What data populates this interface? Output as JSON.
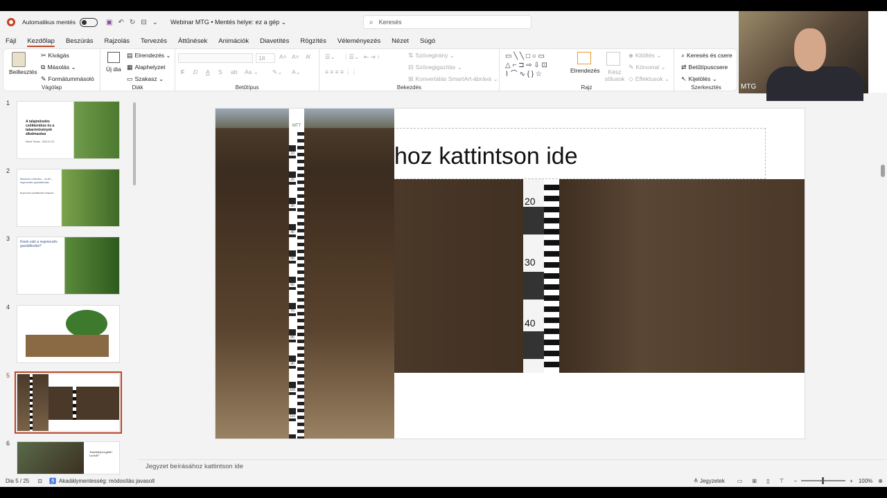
{
  "titlebar": {
    "autosave_label": "Automatikus mentés",
    "doc_title": "Webinar MTG • Mentés helye: ez a gép ⌄",
    "search_placeholder": "Keresés"
  },
  "menu": {
    "tabs": [
      "Fájl",
      "Kezdőlap",
      "Beszúrás",
      "Rajzolás",
      "Tervezés",
      "Áttűnések",
      "Animációk",
      "Diavetítés",
      "Rögzítés",
      "Véleményezés",
      "Nézet",
      "Súgó"
    ],
    "active_tab": "Kezdőlap"
  },
  "ribbon": {
    "clipboard": {
      "paste": "Beillesztés",
      "cut": "Kivágás",
      "copy": "Másolás",
      "format_painter": "Formátummásoló",
      "label": "Vágólap"
    },
    "slides": {
      "new_slide": "Új dia",
      "layout": "Elrendezés",
      "reset": "Alaphelyzet",
      "section": "Szakasz",
      "label": "Diák"
    },
    "font": {
      "size": "18",
      "label": "Betűtípus",
      "bold": "F",
      "italic": "D",
      "underline": "A",
      "strike": "S",
      "case": "Aa"
    },
    "paragraph": {
      "text_direction": "Szövegirány",
      "align_text": "Szövegigazítás",
      "smartart": "Konvertálás SmartArt-ábrává",
      "label": "Bekezdés"
    },
    "drawing": {
      "arrange": "Elrendezés",
      "quick_styles": "Kész stílusok",
      "fill": "Kitöltés",
      "outline": "Körvonal",
      "effects": "Effektusok",
      "label": "Rajz"
    },
    "editing": {
      "find_replace": "Keresés és csere",
      "replace_fonts": "Betűtípuscsere",
      "select": "Kijelölés",
      "label": "Szerkesztés"
    }
  },
  "slides_pane": {
    "thumbs": [
      {
        "num": "1",
        "text": "A talajművelés csökkentése és a takarónövények alkalmazása",
        "sub": "Mezei Tamás - 2024.01.23"
      },
      {
        "num": "2",
        "text": "Minimum művelés – no-till – regeneratív gazdálkodás",
        "sub": "Regeneratív gazdálkodás 5 alapelve"
      },
      {
        "num": "3",
        "text": "Kinek való a regeneratív gazdálkodás?",
        "sub": ""
      },
      {
        "num": "4",
        "text": "",
        "sub": ""
      },
      {
        "num": "5",
        "text": "",
        "sub": ""
      },
      {
        "num": "6",
        "text": "Termőtalajvizsgálat? Laz/tali?",
        "sub": ""
      }
    ],
    "selected": 4
  },
  "slide": {
    "title": "hoz kattintson ide",
    "ruler_left_marks": [
      "10",
      "20",
      "30",
      "40",
      "50",
      "60",
      "70",
      "80",
      "90",
      "100",
      "110"
    ],
    "ruler_left_logo": "MTT",
    "ruler_right_marks": [
      "20",
      "30",
      "40"
    ]
  },
  "notes": {
    "placeholder": "Jegyzet beírásához kattintson ide"
  },
  "status": {
    "slide_count": "Dia 5 / 25",
    "accessibility": "Akadálymentesség: módosítás javasolt",
    "notes_button": "Jegyzetek",
    "zoom": "100%"
  },
  "webcam": {
    "label": "MTG"
  }
}
